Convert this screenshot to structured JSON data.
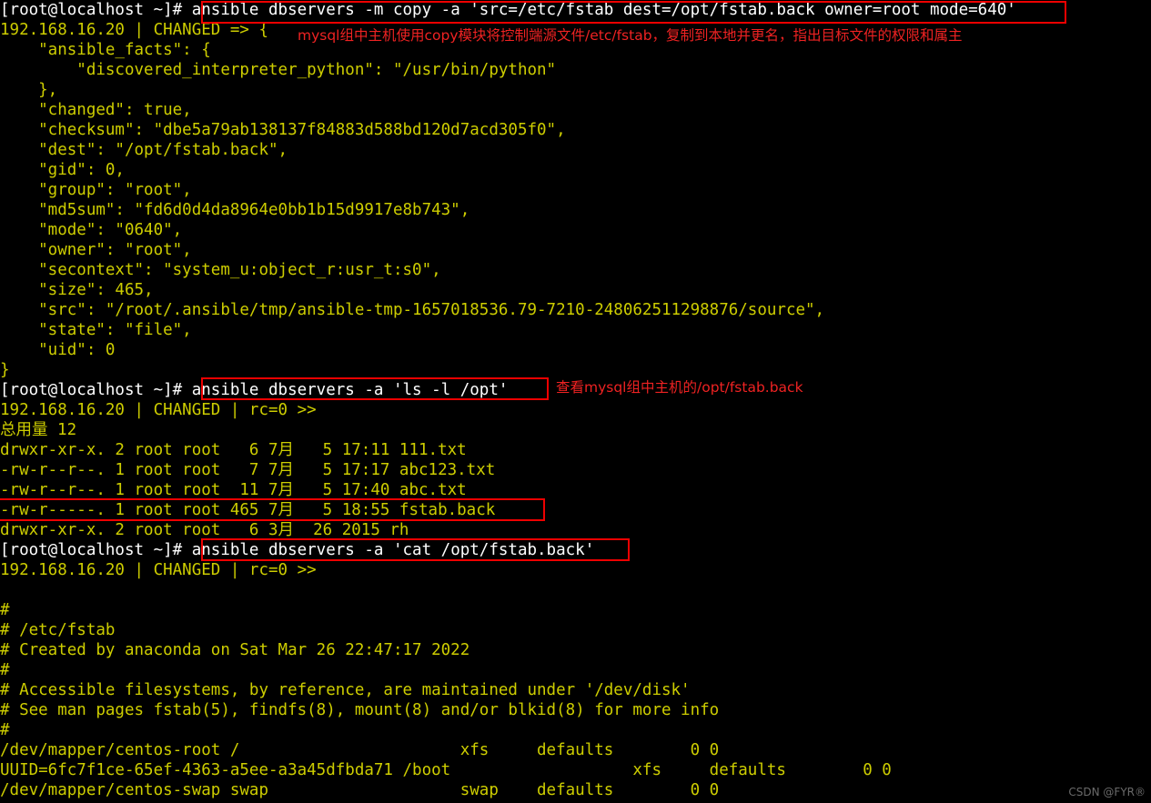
{
  "terminal": {
    "theme": {
      "background": "#000000",
      "output_color": "#cdcd00",
      "prompt_color": "#e6e6e6",
      "annotation_color": "#ee0000"
    },
    "prompt": "[root@localhost ~]# ",
    "lines": [
      {
        "id": "l1",
        "prompt": "[root@localhost ~]# ",
        "text": "ansible dbservers -m copy -a 'src=/etc/fstab dest=/opt/fstab.back owner=root mode=640'",
        "kind": "command"
      },
      {
        "id": "l2",
        "text": "192.168.16.20 | CHANGED => {",
        "kind": "output"
      },
      {
        "id": "l3",
        "text": "    \"ansible_facts\": {",
        "kind": "output"
      },
      {
        "id": "l4",
        "text": "        \"discovered_interpreter_python\": \"/usr/bin/python\"",
        "kind": "output"
      },
      {
        "id": "l5",
        "text": "    },",
        "kind": "output"
      },
      {
        "id": "l6",
        "text": "    \"changed\": true,",
        "kind": "output"
      },
      {
        "id": "l7",
        "text": "    \"checksum\": \"dbe5a79ab138137f84883d588bd120d7acd305f0\",",
        "kind": "output"
      },
      {
        "id": "l8",
        "text": "    \"dest\": \"/opt/fstab.back\",",
        "kind": "output"
      },
      {
        "id": "l9",
        "text": "    \"gid\": 0,",
        "kind": "output"
      },
      {
        "id": "l10",
        "text": "    \"group\": \"root\",",
        "kind": "output"
      },
      {
        "id": "l11",
        "text": "    \"md5sum\": \"fd6d0d4da8964e0bb1b15d9917e8b743\",",
        "kind": "output"
      },
      {
        "id": "l12",
        "text": "    \"mode\": \"0640\",",
        "kind": "output"
      },
      {
        "id": "l13",
        "text": "    \"owner\": \"root\",",
        "kind": "output"
      },
      {
        "id": "l14",
        "text": "    \"secontext\": \"system_u:object_r:usr_t:s0\",",
        "kind": "output"
      },
      {
        "id": "l15",
        "text": "    \"size\": 465,",
        "kind": "output"
      },
      {
        "id": "l16",
        "text": "    \"src\": \"/root/.ansible/tmp/ansible-tmp-1657018536.79-7210-248062511298876/source\",",
        "kind": "output"
      },
      {
        "id": "l17",
        "text": "    \"state\": \"file\",",
        "kind": "output"
      },
      {
        "id": "l18",
        "text": "    \"uid\": 0",
        "kind": "output"
      },
      {
        "id": "l19",
        "text": "}",
        "kind": "output"
      },
      {
        "id": "l20",
        "prompt": "[root@localhost ~]# ",
        "text": "ansible dbservers -a 'ls -l /opt'",
        "kind": "command"
      },
      {
        "id": "l21",
        "text": "192.168.16.20 | CHANGED | rc=0 >>",
        "kind": "output"
      },
      {
        "id": "l22",
        "text": "总用量 12",
        "kind": "output"
      },
      {
        "id": "l23",
        "text": "drwxr-xr-x. 2 root root   6 7月   5 17:11 111.txt",
        "kind": "output"
      },
      {
        "id": "l24",
        "text": "-rw-r--r--. 1 root root   7 7月   5 17:17 abc123.txt",
        "kind": "output"
      },
      {
        "id": "l25",
        "text": "-rw-r--r--. 1 root root  11 7月   5 17:40 abc.txt",
        "kind": "output"
      },
      {
        "id": "l26",
        "text": "-rw-r-----. 1 root root 465 7月   5 18:55 fstab.back",
        "kind": "output"
      },
      {
        "id": "l27",
        "text": "drwxr-xr-x. 2 root root   6 3月  26 2015 rh",
        "kind": "output"
      },
      {
        "id": "l28",
        "prompt": "[root@localhost ~]# ",
        "text": "ansible dbservers -a 'cat /opt/fstab.back'",
        "kind": "command"
      },
      {
        "id": "l29",
        "text": "192.168.16.20 | CHANGED | rc=0 >>",
        "kind": "output"
      },
      {
        "id": "l30",
        "text": "",
        "kind": "blank"
      },
      {
        "id": "l31",
        "text": "#",
        "kind": "output"
      },
      {
        "id": "l32",
        "text": "# /etc/fstab",
        "kind": "output"
      },
      {
        "id": "l33",
        "text": "# Created by anaconda on Sat Mar 26 22:47:17 2022",
        "kind": "output"
      },
      {
        "id": "l34",
        "text": "#",
        "kind": "output"
      },
      {
        "id": "l35",
        "text": "# Accessible filesystems, by reference, are maintained under '/dev/disk'",
        "kind": "output"
      },
      {
        "id": "l36",
        "text": "# See man pages fstab(5), findfs(8), mount(8) and/or blkid(8) for more info",
        "kind": "output"
      },
      {
        "id": "l37",
        "text": "#",
        "kind": "output"
      },
      {
        "id": "l38",
        "text": "/dev/mapper/centos-root /                       xfs     defaults        0 0",
        "kind": "output"
      },
      {
        "id": "l39",
        "text": "UUID=6fc7f1ce-65ef-4363-a5ee-a3a45dfbda71 /boot                   xfs     defaults        0 0",
        "kind": "output"
      },
      {
        "id": "l40",
        "text": "/dev/mapper/centos-swap swap                    swap    defaults        0 0",
        "kind": "output"
      }
    ],
    "annotations": [
      {
        "id": "a1",
        "text": "mysql组中主机使用copy模块将控制端源文件/etc/fstab，复制到本地并更名，指出目标文件的权限和属主"
      },
      {
        "id": "a2",
        "text": "查看mysql组中主机的/opt/fstab.back"
      }
    ],
    "watermark": "CSDN @FYR®"
  }
}
